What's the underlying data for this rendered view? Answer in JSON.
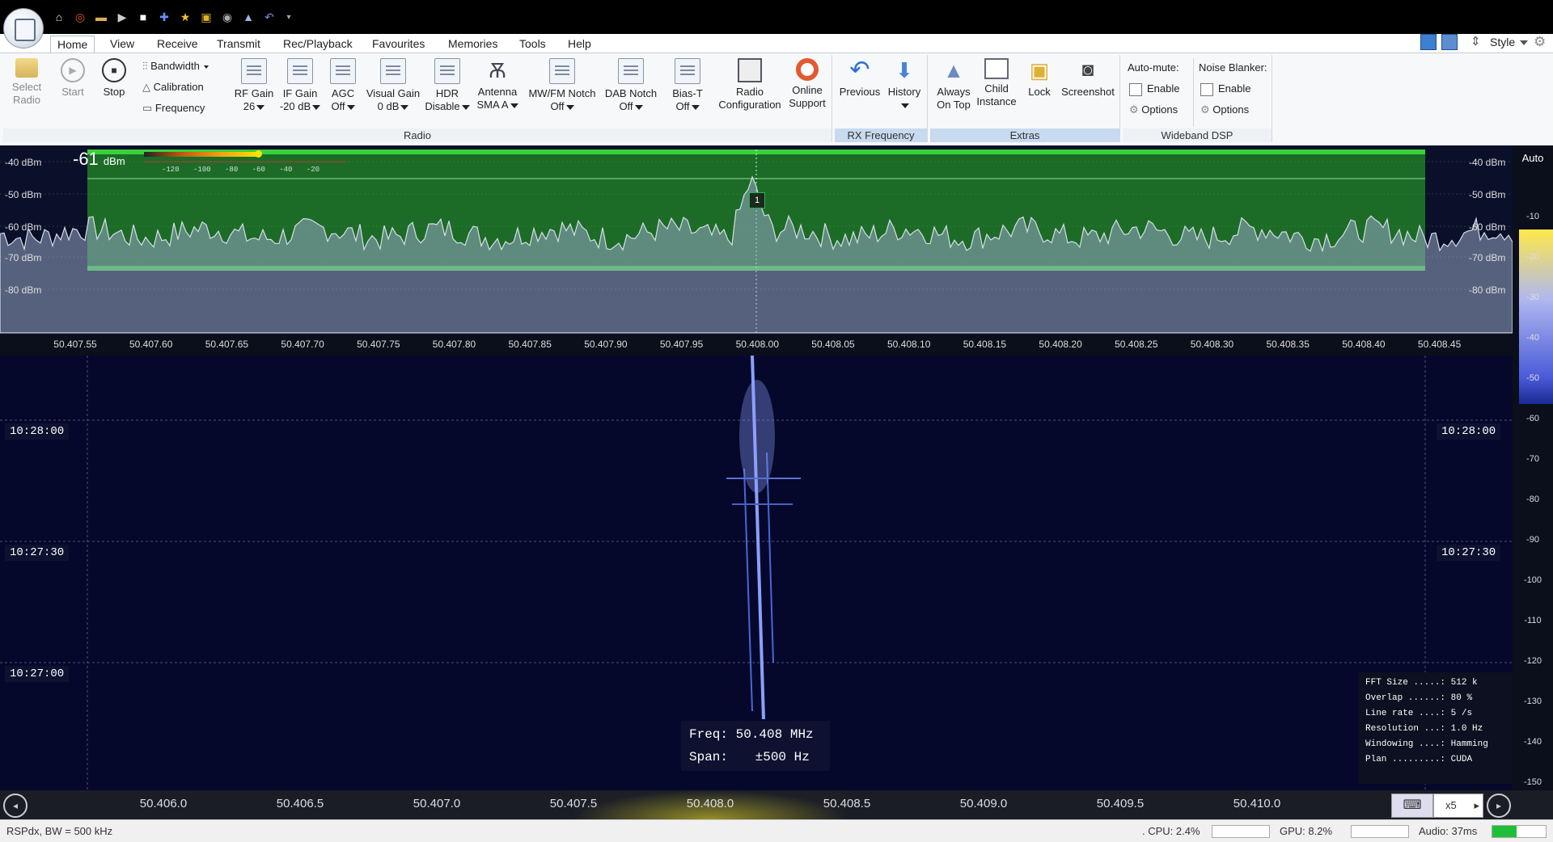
{
  "app": {
    "title_menu": "App Menu"
  },
  "tabs": [
    "Home",
    "View",
    "Receive",
    "Transmit",
    "Rec/Playback",
    "Favourites",
    "Memories",
    "Tools",
    "Help"
  ],
  "active_tab": "Home",
  "top_right": {
    "style_label": "Style"
  },
  "ribbon": {
    "select_radio": {
      "line1": "Select",
      "line2": "Radio"
    },
    "start": "Start",
    "stop": "Stop",
    "bandwidth": "Bandwidth",
    "calibration": "Calibration",
    "frequency": "Frequency",
    "rf_gain": {
      "label": "RF Gain",
      "value": "26"
    },
    "if_gain": {
      "label": "IF Gain",
      "value": "-20 dB"
    },
    "agc": {
      "label": "AGC",
      "value": "Off"
    },
    "visual_gain": {
      "label": "Visual Gain",
      "value": "0 dB"
    },
    "hdr": {
      "label": "HDR",
      "value": "Disable"
    },
    "antenna": {
      "label": "Antenna",
      "value": "SMA A"
    },
    "mwfm_notch": {
      "label": "MW/FM Notch",
      "value": "Off"
    },
    "dab_notch": {
      "label": "DAB Notch",
      "value": "Off"
    },
    "bias_t": {
      "label": "Bias-T",
      "value": "Off"
    },
    "radio_config": {
      "line1": "Radio",
      "line2": "Configuration"
    },
    "online_support": {
      "line1": "Online",
      "line2": "Support"
    },
    "group_radio": "Radio",
    "previous": "Previous",
    "history": "History",
    "group_rx": "RX Frequency",
    "always_on_top": {
      "line1": "Always",
      "line2": "On Top"
    },
    "child_instance": {
      "line1": "Child",
      "line2": "Instance"
    },
    "lock": "Lock",
    "screenshot": "Screenshot",
    "group_extras": "Extras",
    "auto_mute": {
      "title": "Auto-mute:",
      "enable": "Enable",
      "options": "Options"
    },
    "noise_blanker": {
      "title": "Noise Blanker:",
      "enable": "Enable",
      "options": "Options"
    },
    "group_wideband": "Wideband DSP"
  },
  "spectrum": {
    "level_value": "-61",
    "level_unit": "dBm",
    "meter_ticks": [
      "-120",
      "-100",
      "-80",
      "-60",
      "-40",
      "-20"
    ],
    "db_labels": [
      "-40 dBm",
      "-50 dBm",
      "-60 dBm",
      "-70 dBm",
      "-80 dBm"
    ],
    "marker": "1",
    "freq_ticks": [
      "50.407.55",
      "50.407.60",
      "50.407.65",
      "50.407.70",
      "50.407.75",
      "50.407.80",
      "50.407.85",
      "50.407.90",
      "50.407.95",
      "50.408.00",
      "50.408.05",
      "50.408.10",
      "50.408.15",
      "50.408.20",
      "50.408.25",
      "50.408.30",
      "50.408.35",
      "50.408.40",
      "50.408.45"
    ]
  },
  "waterfall": {
    "times": [
      "10:28:00",
      "10:27:30",
      "10:27:00"
    ],
    "freq_box": {
      "freq_label": "Freq:",
      "freq_value": "50.408 MHz",
      "span_label": "Span:",
      "span_value": "±500 Hz"
    },
    "info": [
      {
        "k": "FFT Size .....:",
        "v": "512 k"
      },
      {
        "k": "Overlap ......:",
        "v": "80 %"
      },
      {
        "k": "Line rate ....:",
        "v": "5 /s"
      },
      {
        "k": "Resolution ...:",
        "v": "1.0 Hz"
      },
      {
        "k": "Windowing ....:",
        "v": "Hamming"
      },
      {
        "k": "Plan .........:",
        "v": "CUDA"
      }
    ]
  },
  "scale": {
    "auto": "Auto",
    "ticks": [
      "-10",
      "-20",
      "-30",
      "-40",
      "-50",
      "-60",
      "-70",
      "-80",
      "-90",
      "-100",
      "-110",
      "-120",
      "-130",
      "-140",
      "-150"
    ]
  },
  "overview": {
    "ticks": [
      "50.406.0",
      "50.406.5",
      "50.407.0",
      "50.407.5",
      "50.408.0",
      "50.408.5",
      "50.409.0",
      "50.409.5",
      "50.410.0"
    ],
    "zoom": "x5"
  },
  "status": {
    "device": "RSPdx, BW = 500 kHz",
    "cpu": ". CPU: 2.4%",
    "gpu": "GPU: 8.2%",
    "audio": "Audio: 37ms"
  }
}
